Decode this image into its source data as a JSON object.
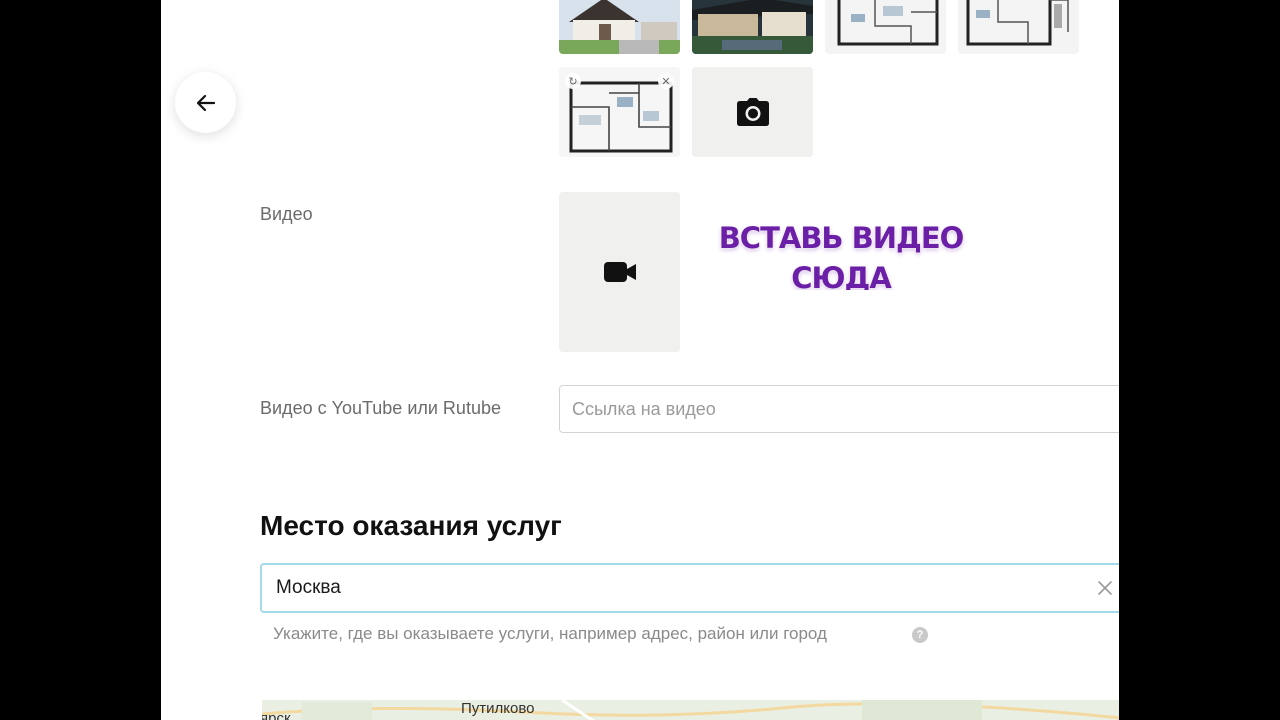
{
  "video": {
    "label": "Видео",
    "promo_line1": "ВСТАВЬ ВИДЕО",
    "promo_line2": "СЮДА"
  },
  "video_link": {
    "label": "Видео с YouTube или Rutube",
    "placeholder": "Ссылка на видео"
  },
  "location": {
    "title": "Место оказания услуг",
    "value": "Москва",
    "hint": "Укажите, где вы оказываете услуги, например адрес, район или город",
    "help_glyph": "?"
  },
  "map": {
    "labels": [
      "Путилково",
      "ярск"
    ]
  },
  "colors": {
    "promo_text": "#6a1fa6",
    "focus_border": "#a4d9ea",
    "tile_bg": "#f0f0ee"
  },
  "icons": {
    "back": "arrow-left-icon",
    "add_photo": "camera-icon",
    "add_video": "video-camera-icon",
    "clear": "close-icon",
    "help": "question-circle-icon"
  }
}
